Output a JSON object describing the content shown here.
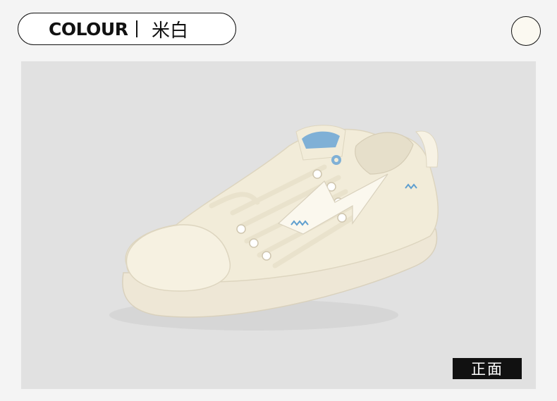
{
  "header": {
    "colour_label": "COLOUR",
    "colour_value": "米白"
  },
  "swatch": {
    "color": "#fbf9f1"
  },
  "photo": {
    "view_label": "正面",
    "subject": "shoe-illustration"
  },
  "colors": {
    "background": "#f4f4f4",
    "photo_background": "#e1e1e1",
    "shoe_body": "#f2ecd9",
    "accent_blue": "#7fb0d6"
  }
}
